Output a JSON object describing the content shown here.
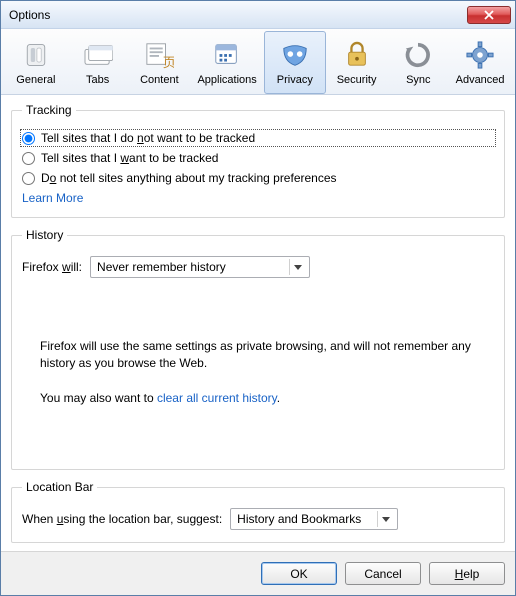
{
  "window": {
    "title": "Options"
  },
  "tabs": {
    "general": "General",
    "tabs": "Tabs",
    "content": "Content",
    "applications": "Applications",
    "privacy": "Privacy",
    "security": "Security",
    "sync": "Sync",
    "advanced": "Advanced"
  },
  "tracking": {
    "legend": "Tracking",
    "opt1_pre": "Tell sites that I do ",
    "opt1_u": "n",
    "opt1_post": "ot want to be tracked",
    "opt2_pre": "Tell sites that I ",
    "opt2_u": "w",
    "opt2_post": "ant to be tracked",
    "opt3_pre": "D",
    "opt3_u": "o",
    "opt3_post": " not tell sites anything about my tracking preferences",
    "learn": "Learn More"
  },
  "history": {
    "legend": "History",
    "label_pre": "Firefox ",
    "label_u": "w",
    "label_post": "ill:",
    "select_value": "Never remember history",
    "text1": "Firefox will use the same settings as private browsing, and will not remember any history as you browse the Web.",
    "text2_pre": "You may also want to ",
    "text2_link": "clear all current history",
    "text2_post": "."
  },
  "locationbar": {
    "legend": "Location Bar",
    "label_pre": "When ",
    "label_u": "u",
    "label_post": "sing the location bar, suggest:",
    "select_value": "History and Bookmarks"
  },
  "footer": {
    "ok": "OK",
    "cancel": "Cancel",
    "help_u": "H",
    "help_post": "elp"
  }
}
